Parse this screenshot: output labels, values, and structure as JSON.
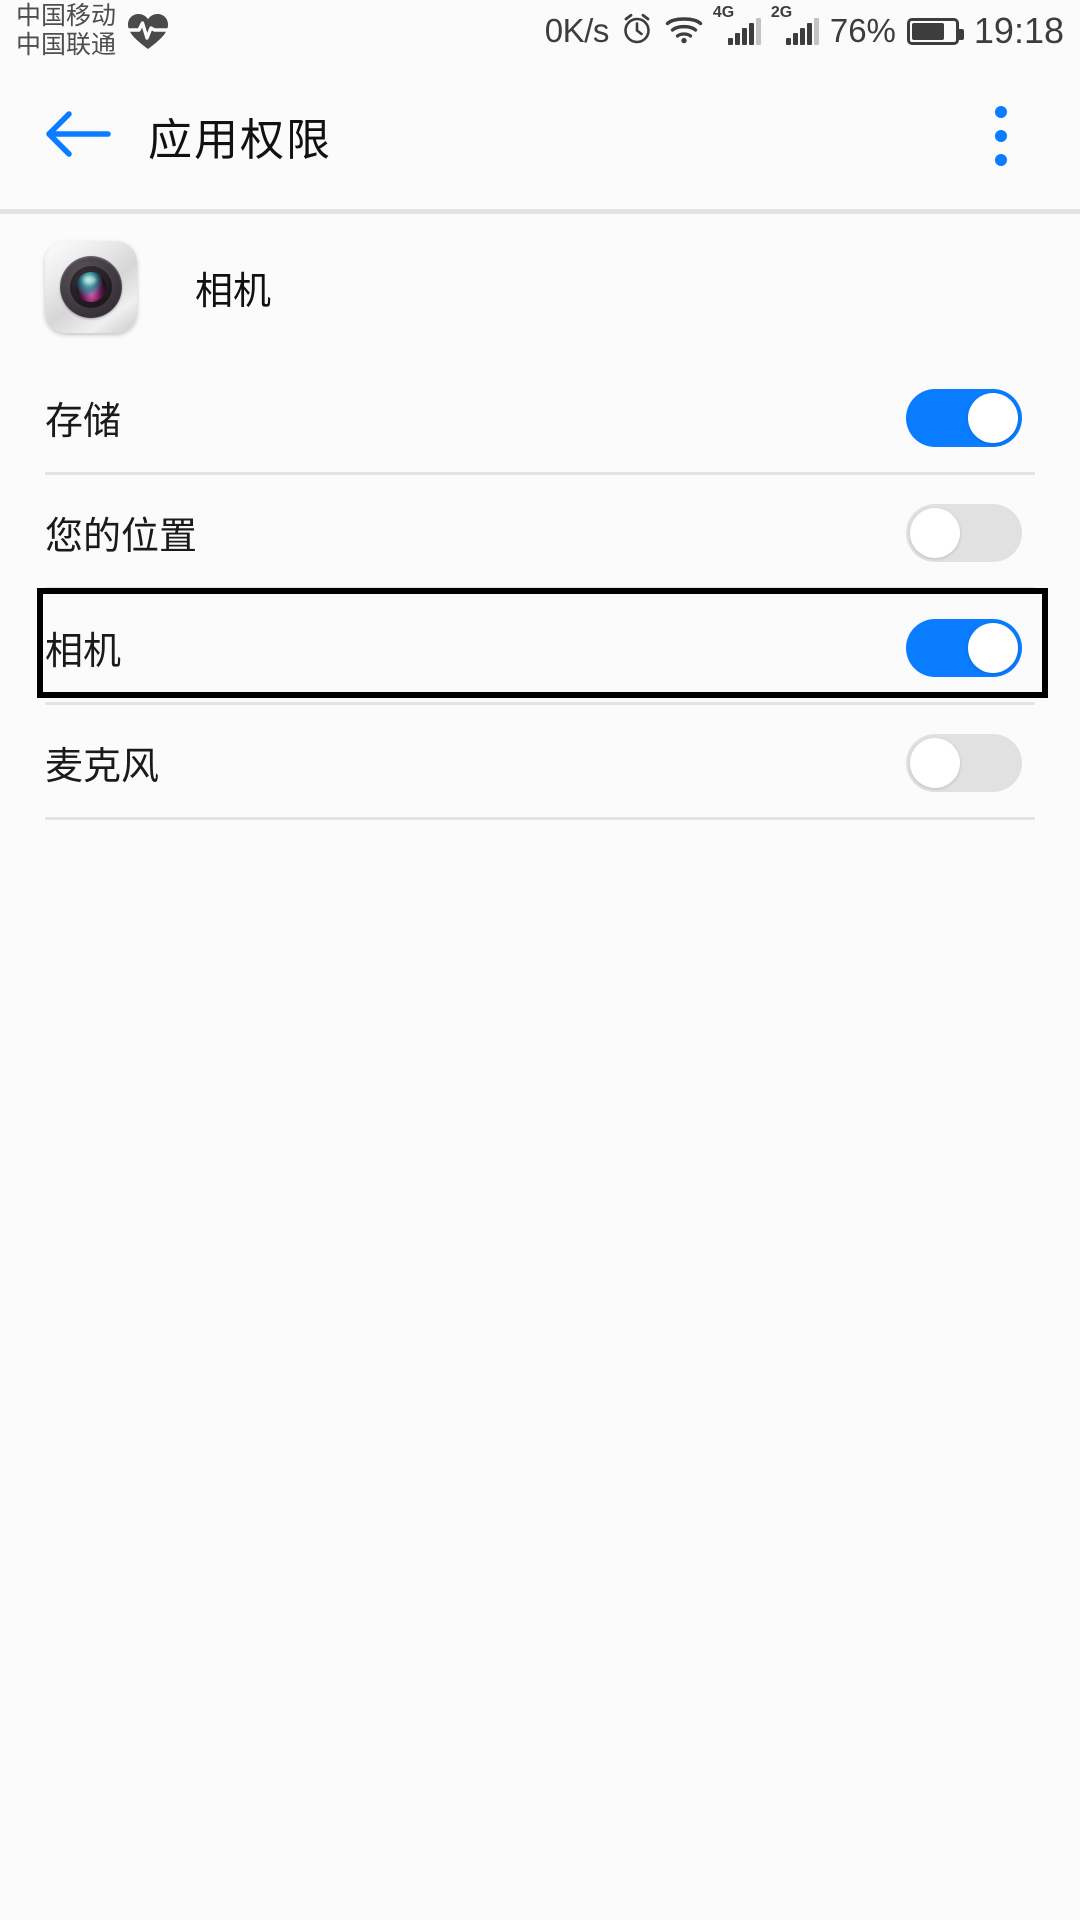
{
  "status_bar": {
    "carrier_line1": "中国移动",
    "carrier_line2": "中国联通",
    "health_icon": "heartbeat-icon",
    "network_speed": "0K/s",
    "alarm_icon": "alarm-clock-icon",
    "wifi_icon": "wifi-icon",
    "sim1_network": "4G",
    "sim1_bars": 4,
    "sim2_network": "2G",
    "sim2_bars": 4,
    "battery_percent": "76%",
    "battery_level": 76,
    "time": "19:18"
  },
  "app_bar": {
    "back_icon": "back-arrow-icon",
    "title": "应用权限",
    "overflow_icon": "more-vertical-icon",
    "accent_color": "#0a7cff"
  },
  "app_header": {
    "app_icon": "camera-app-icon",
    "app_name": "相机"
  },
  "permissions": [
    {
      "label": "存储",
      "enabled": true,
      "highlighted": false
    },
    {
      "label": "您的位置",
      "enabled": false,
      "highlighted": false
    },
    {
      "label": "相机",
      "enabled": true,
      "highlighted": true
    },
    {
      "label": "麦克风",
      "enabled": false,
      "highlighted": false
    }
  ],
  "colors": {
    "toggle_on": "#0a7cff",
    "toggle_off": "#e1e1e1",
    "background": "#fbfbfb",
    "divider": "#e4e4e4",
    "annotation": "#000000"
  }
}
